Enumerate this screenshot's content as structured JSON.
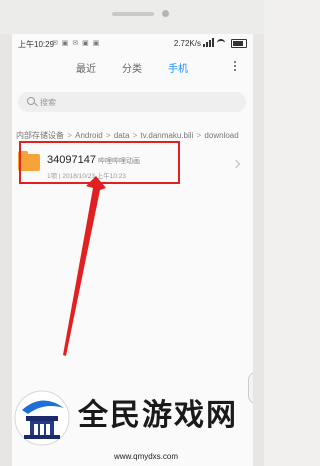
{
  "status_bar": {
    "time": "上午10:29",
    "left_icons": "✉ ▣ ✉ ▣ ▣",
    "speed": "2.72K/s",
    "battery_level": 0.8
  },
  "tabs": [
    {
      "label": "最近",
      "active": false
    },
    {
      "label": "分类",
      "active": false
    },
    {
      "label": "手机",
      "active": true
    }
  ],
  "search": {
    "placeholder": "搜索"
  },
  "breadcrumb": [
    "内部存储设备",
    "Android",
    "data",
    "tv.danmaku.bili",
    "download"
  ],
  "file": {
    "name": "34097147",
    "tag": "哔哩哔哩动画",
    "meta": "1项  |  2018/10/23 上午10:23",
    "icon": "folder-icon"
  },
  "watermark": {
    "title": "全民游戏网",
    "url": "www.qmydxs.com"
  },
  "colors": {
    "accent": "#1e90ff",
    "highlight": "#e12121",
    "folder": "#f6a33a"
  }
}
